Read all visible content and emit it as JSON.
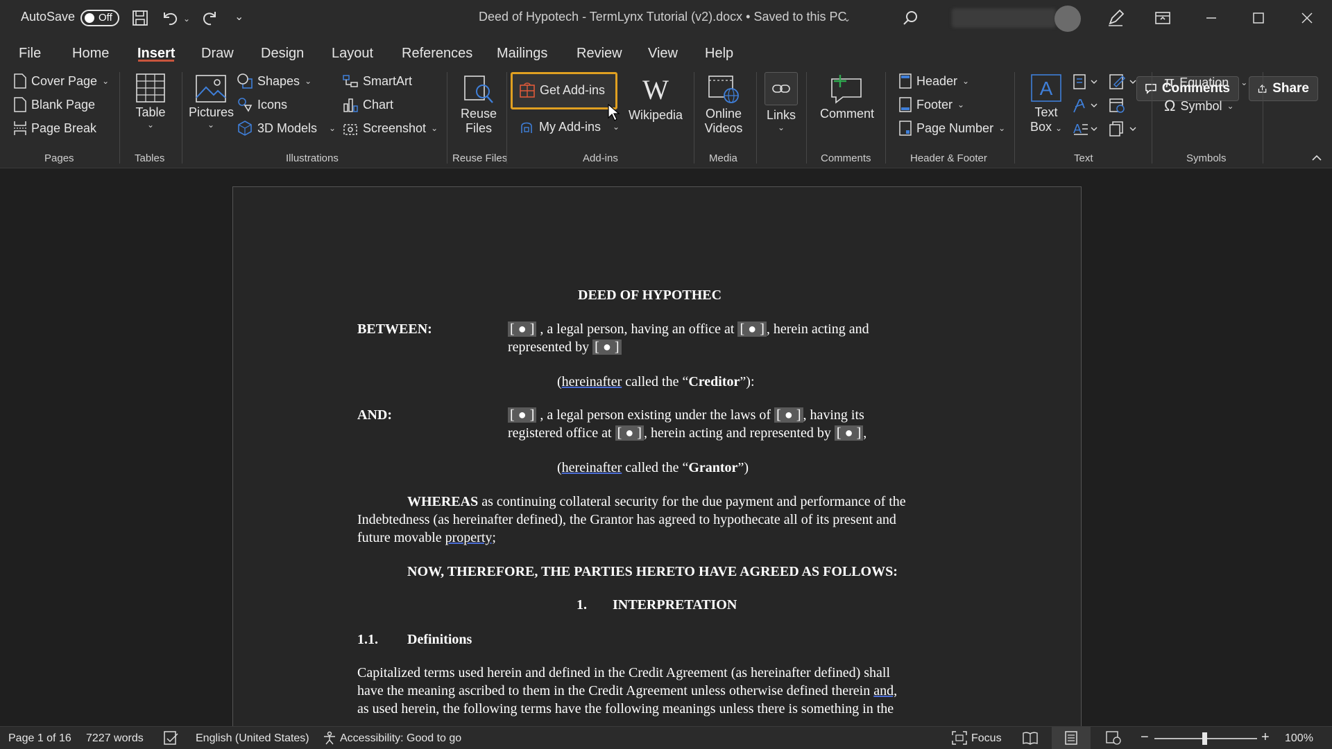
{
  "titlebar": {
    "autosave_label": "AutoSave",
    "autosave_state": "Off",
    "document_title": "Deed of Hypotech - TermLynx Tutorial (v2).docx • Saved to this PC"
  },
  "menu_tabs": [
    "File",
    "Home",
    "Insert",
    "Draw",
    "Design",
    "Layout",
    "References",
    "Mailings",
    "Review",
    "View",
    "Help"
  ],
  "active_tab": "Insert",
  "actions": {
    "comments": "Comments",
    "share": "Share"
  },
  "ribbon": {
    "pages": {
      "cover_page": "Cover Page",
      "blank_page": "Blank Page",
      "page_break": "Page Break",
      "group": "Pages"
    },
    "tables": {
      "table": "Table",
      "group": "Tables"
    },
    "illustrations": {
      "pictures": "Pictures",
      "shapes": "Shapes",
      "icons": "Icons",
      "models": "3D Models",
      "smartart": "SmartArt",
      "chart": "Chart",
      "screenshot": "Screenshot",
      "group": "Illustrations"
    },
    "reuse": {
      "line1": "Reuse",
      "line2": "Files",
      "group": "Reuse Files"
    },
    "addins": {
      "get": "Get Add-ins",
      "my": "My Add-ins",
      "wikipedia": "Wikipedia",
      "group": "Add-ins"
    },
    "media": {
      "line1": "Online",
      "line2": "Videos",
      "group": "Media"
    },
    "links": {
      "label": "Links"
    },
    "comments": {
      "comment": "Comment",
      "group": "Comments"
    },
    "header_footer": {
      "header": "Header",
      "footer": "Footer",
      "page_number": "Page Number",
      "group": "Header & Footer"
    },
    "text": {
      "line1": "Text",
      "line2": "Box",
      "group": "Text"
    },
    "symbols": {
      "equation": "Equation",
      "symbol": "Symbol",
      "group": "Symbols"
    }
  },
  "document": {
    "title": "DEED OF HYPOTHEC",
    "between_label": "BETWEEN:",
    "placeholder": "[ ● ]",
    "between_l1a": " , a legal person, having an office at ",
    "between_l1b": ", herein acting and",
    "between_l2": "represented by ",
    "creditor_a": "hereinafter",
    "creditor_b": " called the “",
    "creditor_c": "Creditor",
    "creditor_d": "”):",
    "and_label": "AND:",
    "and_l1a": " , a legal person existing under the laws of ",
    "and_l1b": ", having its",
    "and_l2a": "registered office at ",
    "and_l2b": ", herein acting and represented by ",
    "and_l2c": ",",
    "grantor_a": "hereinafter",
    "grantor_b": " called the “",
    "grantor_c": "Grantor",
    "grantor_d": "”)",
    "whereas_bold": "WHEREAS",
    "whereas_l1": " as continuing collateral security for the due payment and performance of the",
    "whereas_l2": "Indebtedness (as hereinafter defined), the Grantor has agreed to hypothecate all of its present and",
    "whereas_l3a": "future movable ",
    "whereas_l3b": "property;",
    "now_therefore": "NOW, THEREFORE, THE PARTIES HERETO HAVE AGREED AS FOLLOWS:",
    "sec1_num": "1.",
    "sec1_title": "INTERPRETATION",
    "sec11_num": "1.1.",
    "sec11_title": "Definitions",
    "defs_l1": "Capitalized terms used herein and defined in the Credit Agreement (as hereinafter defined) shall",
    "defs_l2a": "have the meaning ascribed to them in the Credit Agreement unless otherwise defined therein ",
    "defs_l2b": "and,",
    "defs_l3": "as used herein, the following terms have the following meanings unless there is something in the"
  },
  "statusbar": {
    "page": "Page 1 of 16",
    "words": "7227 words",
    "language": "English (United States)",
    "accessibility": "Accessibility: Good to go",
    "focus": "Focus",
    "zoom": "100%"
  },
  "colors": {
    "highlight": "#e0a021",
    "active_tab_underline": "#c8553d",
    "accent_blue": "#3f7fd9"
  }
}
